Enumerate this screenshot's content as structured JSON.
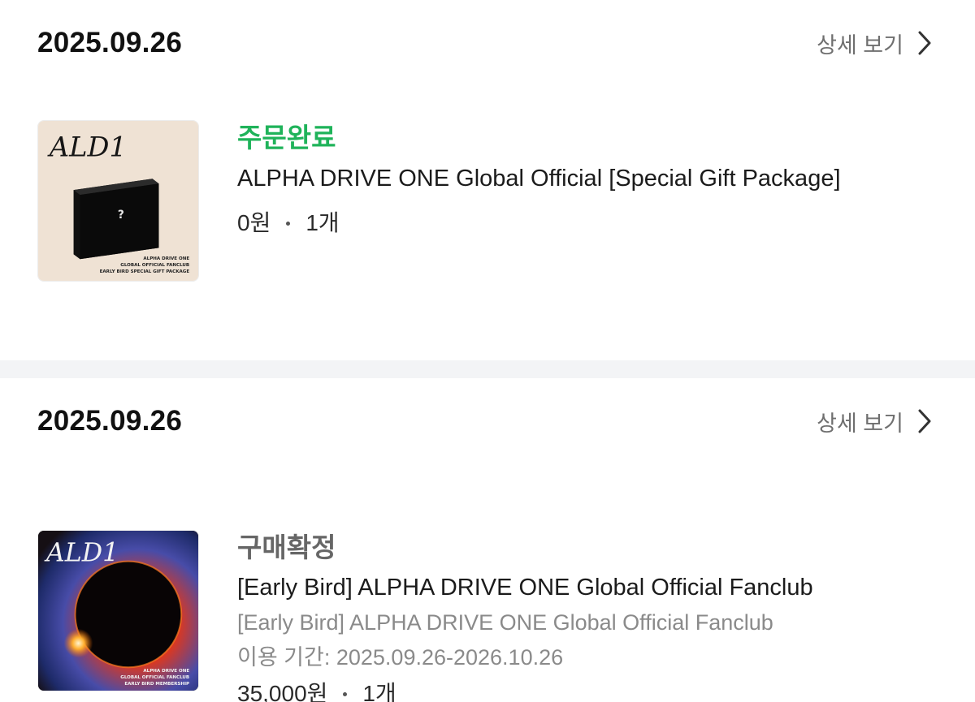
{
  "orders": [
    {
      "date": "2025.09.26",
      "detail_label": "상세 보기",
      "status": "주문완료",
      "status_color": "#1fb35a",
      "title": "ALPHA DRIVE ONE Global Official [Special Gift Package]",
      "price": "0원",
      "quantity": "1개",
      "thumbnail": {
        "logo": "ALD1",
        "box_mark": "?",
        "caption_lines": [
          "ALPHA DRIVE ONE",
          "GLOBAL OFFICIAL FANCLUB",
          "EARLY BIRD SPECIAL GIFT PACKAGE"
        ],
        "background": "#efe2d4"
      }
    },
    {
      "date": "2025.09.26",
      "detail_label": "상세 보기",
      "status": "구매확정",
      "status_color": "#666666",
      "title": "[Early Bird] ALPHA DRIVE ONE Global Official Fanclub",
      "option": "[Early Bird] ALPHA DRIVE ONE Global Official Fanclub",
      "period": "이용 기간: 2025.09.26-2026.10.26",
      "price": "35,000원",
      "quantity": "1개",
      "thumbnail": {
        "logo": "ALD1",
        "caption_lines": [
          "ALPHA DRIVE ONE",
          "GLOBAL OFFICIAL FANCLUB",
          "EARLY BIRD MEMBERSHIP"
        ],
        "background": "#1a1212"
      }
    }
  ]
}
